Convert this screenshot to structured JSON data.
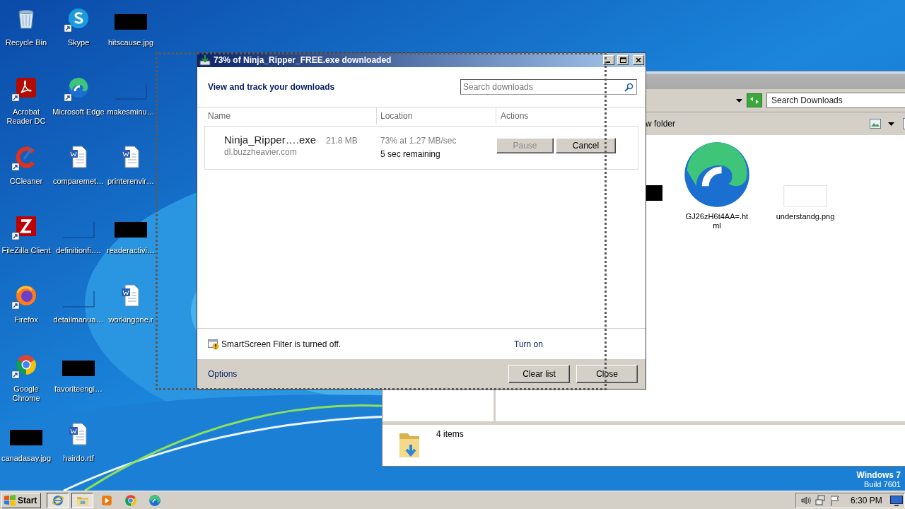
{
  "desktop_icons": [
    {
      "label": "Recycle Bin",
      "kind": "recycle",
      "shortcut": false
    },
    {
      "label": "Acrobat Reader DC",
      "kind": "acrobat",
      "shortcut": true
    },
    {
      "label": "CCleaner",
      "kind": "ccleaner",
      "shortcut": true
    },
    {
      "label": "FileZilla Client",
      "kind": "filezilla",
      "shortcut": true
    },
    {
      "label": "Firefox",
      "kind": "firefox",
      "shortcut": true
    },
    {
      "label": "Google Chrome",
      "kind": "chrome",
      "shortcut": true
    },
    {
      "label": "canadasay.jpg",
      "kind": "dark",
      "shortcut": false
    },
    {
      "label": "Skype",
      "kind": "skype",
      "shortcut": true
    },
    {
      "label": "Microsoft Edge",
      "kind": "edge",
      "shortcut": true
    },
    {
      "label": "comparemet…",
      "kind": "word",
      "shortcut": false
    },
    {
      "label": "definitionfi….",
      "kind": "blank",
      "shortcut": false
    },
    {
      "label": "detailmanua…",
      "kind": "blank",
      "shortcut": false
    },
    {
      "label": "favoriteengi…",
      "kind": "dark",
      "shortcut": false
    },
    {
      "label": "hairdo.rtf",
      "kind": "word",
      "shortcut": false
    },
    {
      "label": "hitscause.jpg",
      "kind": "dark",
      "shortcut": false
    },
    {
      "label": "makesminu…",
      "kind": "blank",
      "shortcut": false
    },
    {
      "label": "printerenvir…",
      "kind": "word",
      "shortcut": false
    },
    {
      "label": "readeractivi…",
      "kind": "dark",
      "shortcut": false
    },
    {
      "label": "workingone.r",
      "kind": "word",
      "shortcut": false
    }
  ],
  "explorer": {
    "search": {
      "placeholder": "Search Downloads"
    },
    "toolbar_text": "w folder",
    "files": [
      {
        "kind": "dark"
      },
      {
        "kind": "edge",
        "label": "GJ26zH6t4AA=.html"
      },
      {
        "kind": "blankpng",
        "label": "understandg.png"
      }
    ],
    "status": "4 items"
  },
  "dialog": {
    "title": "73% of Ninja_Ripper_FREE.exe downloaded",
    "heading": "View and track your downloads",
    "search": {
      "placeholder": "Search downloads"
    },
    "columns": [
      "Name",
      "Location",
      "Actions"
    ],
    "downloads": [
      {
        "name": "Ninja_Ripper….exe",
        "size": "21.8 MB",
        "source": "dl.buzzheavier.com",
        "progress": "73% at 1.27 MB/sec",
        "remaining": "5 sec remaining",
        "actions": [
          {
            "label": "Pause",
            "disabled": true
          },
          {
            "label": "Cancel",
            "disabled": false
          }
        ]
      }
    ],
    "smartscreen": {
      "message": "SmartScreen Filter is turned off.",
      "link": "Turn on"
    },
    "footer": {
      "link": "Options",
      "buttons": [
        "Clear list",
        "Close"
      ]
    }
  },
  "os_label": {
    "name": "Windows 7",
    "build": "Build 7601"
  },
  "taskbar": {
    "start": "Start",
    "apps": [
      {
        "kind": "ie",
        "open": true
      },
      {
        "kind": "folder",
        "open": true
      },
      {
        "kind": "media",
        "open": false
      },
      {
        "kind": "chrome",
        "open": false
      },
      {
        "kind": "edge",
        "open": false
      }
    ],
    "clock": "6:30 PM"
  }
}
